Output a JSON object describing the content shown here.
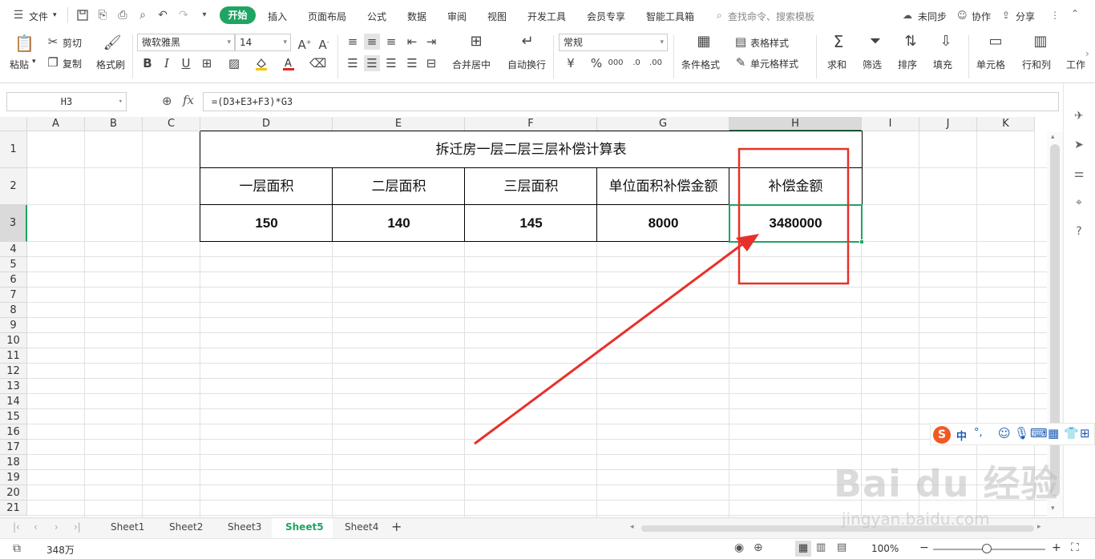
{
  "menubar": {
    "file_label": "文件",
    "tabs": [
      "开始",
      "插入",
      "页面布局",
      "公式",
      "数据",
      "审阅",
      "视图",
      "开发工具",
      "会员专享",
      "智能工具箱"
    ],
    "active_tab": "开始",
    "search_placeholder": "查找命令、搜索模板",
    "sync_label": "未同步",
    "collab_label": "协作",
    "share_label": "分享"
  },
  "ribbon": {
    "paste": "粘贴",
    "cut": "剪切",
    "copy": "复制",
    "format_painter": "格式刷",
    "font_name": "微软雅黑",
    "font_size": "14",
    "merge_center": "合并居中",
    "wrap_text": "自动换行",
    "number_format": "常规",
    "conditional_format": "条件格式",
    "table_style": "表格样式",
    "cell_style": "单元格样式",
    "sum": "求和",
    "filter": "筛选",
    "sort": "排序",
    "fill": "填充",
    "cell": "单元格",
    "row_col": "行和列",
    "worksheet": "工作",
    "bold": "B",
    "italic": "I",
    "underline": "U",
    "currency": "¥",
    "percent": "%"
  },
  "formula_bar": {
    "name_box": "H3",
    "fx": "fx",
    "formula": "=(D3+E3+F3)*G3"
  },
  "grid": {
    "columns": [
      "A",
      "B",
      "C",
      "D",
      "E",
      "F",
      "G",
      "H",
      "I",
      "J",
      "K"
    ],
    "selected_column": "H",
    "rows": [
      "1",
      "2",
      "3",
      "4",
      "5",
      "6",
      "7",
      "8",
      "9",
      "10",
      "11",
      "12",
      "13",
      "14",
      "15",
      "16",
      "17",
      "18",
      "19",
      "20",
      "21"
    ],
    "selected_row": "3",
    "title": "拆迁房一层二层三层补偿计算表",
    "headers": [
      "一层面积",
      "二层面积",
      "三层面积",
      "单位面积补偿金额",
      "补偿金额"
    ],
    "values": [
      "150",
      "140",
      "145",
      "8000",
      "3480000"
    ]
  },
  "sheets": {
    "tabs": [
      "Sheet1",
      "Sheet2",
      "Sheet3",
      "Sheet5",
      "Sheet4"
    ],
    "active": "Sheet5",
    "add_label": "+"
  },
  "status": {
    "summary": "348万",
    "zoom": "100%"
  },
  "ime": {
    "mode": "中",
    "punct": "°,"
  },
  "watermark": {
    "brand": "Bai du 经验",
    "url": "jingyan.baidu.com"
  },
  "colors": {
    "accent": "#1fa463",
    "annotation": "#e8302a"
  }
}
